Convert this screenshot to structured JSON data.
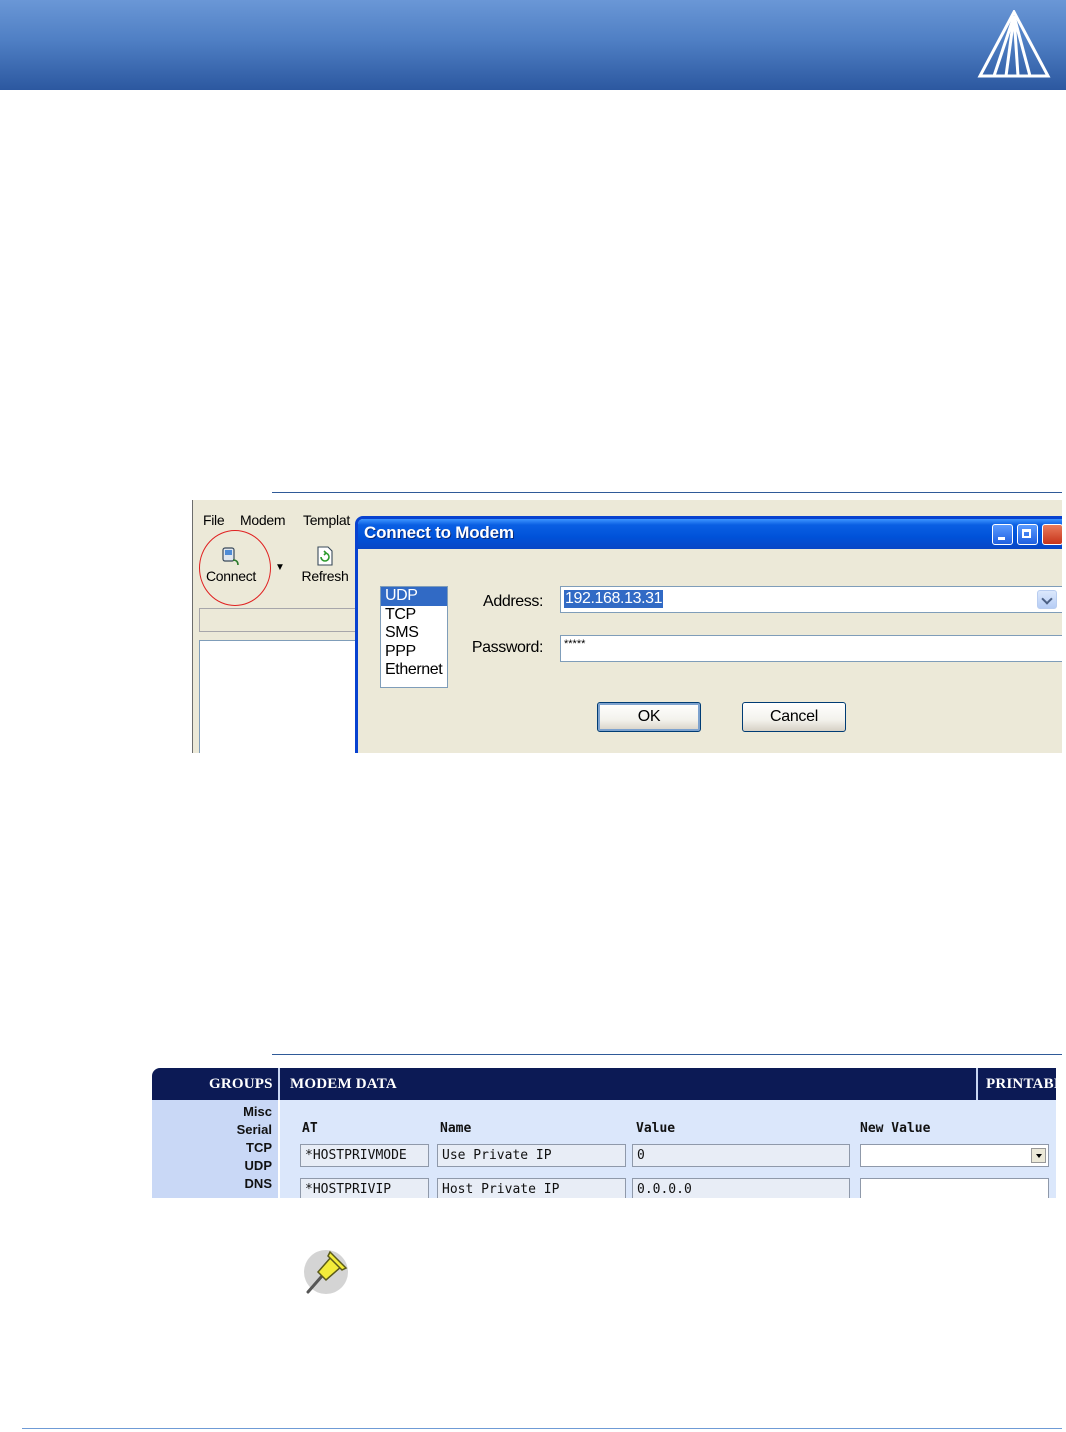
{
  "app_menu": {
    "file": "File",
    "modem": "Modem",
    "template": "Templat"
  },
  "toolbar": {
    "connect_label": "Connect",
    "refresh_label": "Refresh"
  },
  "connect_dialog": {
    "title": "Connect to Modem",
    "protocols": [
      "UDP",
      "TCP",
      "SMS",
      "PPP",
      "Ethernet"
    ],
    "selected_protocol": "UDP",
    "address_label": "Address:",
    "address_value": "192.168.13.31",
    "password_label": "Password:",
    "password_value": "*****",
    "ok_label": "OK",
    "cancel_label": "Cancel"
  },
  "web_config": {
    "groups_header": "GROUPS",
    "modem_data_header": "MODEM DATA",
    "printable_header": "PRINTABI",
    "groups": [
      "Misc",
      "Serial",
      "TCP",
      "UDP",
      "DNS"
    ],
    "columns": [
      "AT",
      "Name",
      "Value",
      "New Value"
    ],
    "rows": [
      {
        "at": "*HOSTPRIVMODE",
        "name": "Use Private IP",
        "value": "0",
        "new_value": ""
      },
      {
        "at": "*HOSTPRIVIP",
        "name": "Host Private IP",
        "value": "0.0.0.0",
        "new_value": ""
      }
    ]
  },
  "colors": {
    "banner": "#4f7fc4",
    "dialog_title": "#0052d9",
    "selection": "#316ac5",
    "web_header": "#0c1a55",
    "highlight_circle": "#e02020"
  }
}
